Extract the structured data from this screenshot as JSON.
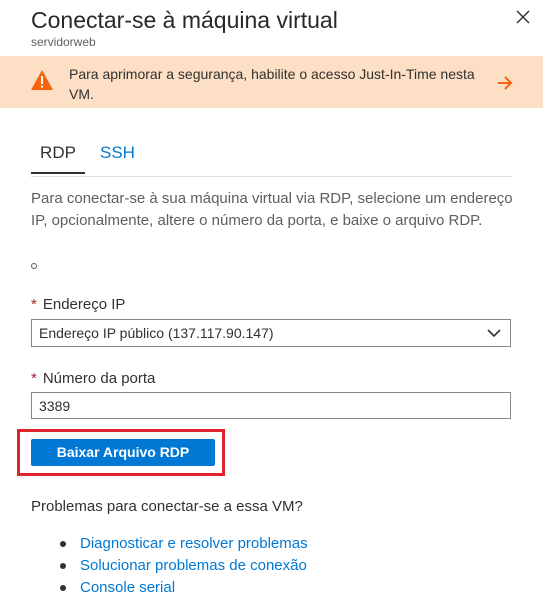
{
  "header": {
    "title": "Conectar-se à máquina virtual",
    "subtitle": "servidorweb",
    "close_icon": "close-icon"
  },
  "banner": {
    "text": "Para aprimorar a segurança, habilite o acesso Just-In-Time nesta VM.",
    "icon": "warning-icon",
    "action_icon": "arrow-right-icon",
    "background": "#fcdfc4",
    "accent": "#f7630c"
  },
  "tabs": [
    {
      "label": "RDP",
      "selected": true
    },
    {
      "label": "SSH",
      "selected": false
    }
  ],
  "description": "Para conectar-se à sua máquina virtual via RDP, selecione um endereço IP, opcionalmente, altere o número da porta, e baixe o arquivo RDP.",
  "form": {
    "required_mark": "*",
    "ip": {
      "label": "Endereço IP",
      "value": "Endereço IP público (137.117.90.147)"
    },
    "port": {
      "label": "Número da porta",
      "value": "3389"
    },
    "download_button": "Baixar Arquivo RDP"
  },
  "help": {
    "question": "Problemas para conectar-se a essa VM?",
    "links": [
      "Diagnosticar e resolver problemas",
      "Solucionar problemas de conexão",
      "Console serial"
    ]
  },
  "colors": {
    "brand": "#0078d4",
    "highlight": "#e0262c",
    "required": "#a4262c"
  }
}
